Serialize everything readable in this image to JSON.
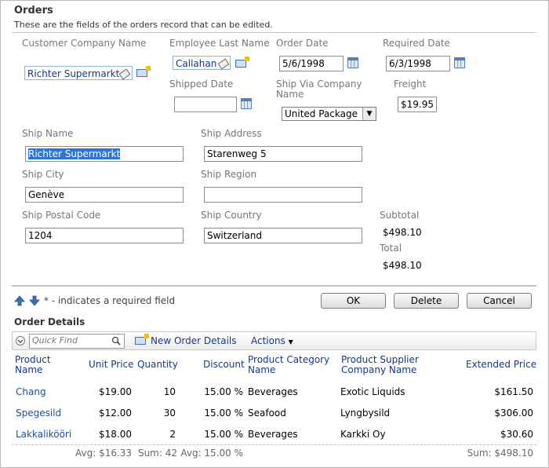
{
  "form": {
    "title": "Orders",
    "description": "These are the fields of the orders record that can be edited.",
    "customer_company_label": "Customer Company Name",
    "customer_company_value": "Richter Supermarkt",
    "employee_last_name_label": "Employee Last Name",
    "employee_last_name_value": "Callahan",
    "order_date_label": "Order Date",
    "order_date_value": "5/6/1998",
    "required_date_label": "Required Date",
    "required_date_value": "6/3/1998",
    "shipped_date_label": "Shipped Date",
    "shipped_date_value": "",
    "ship_via_label": "Ship Via Company Name",
    "ship_via_value": "United Package",
    "freight_label": "Freight",
    "freight_value": "$19.95",
    "ship_name_label": "Ship Name",
    "ship_name_value": "Richter Supermarkt",
    "ship_address_label": "Ship Address",
    "ship_address_value": "Starenweg 5",
    "ship_city_label": "Ship City",
    "ship_city_value": "Genève",
    "ship_region_label": "Ship Region",
    "ship_region_value": "",
    "ship_postal_code_label": "Ship Postal Code",
    "ship_postal_code_value": "1204",
    "ship_country_label": "Ship Country",
    "ship_country_value": "Switzerland",
    "subtotal_label": "Subtotal",
    "subtotal_value": "$498.10",
    "total_label": "Total",
    "total_value": "$498.10"
  },
  "actions_bar": {
    "required_note": "* - indicates a required field",
    "ok_label": "OK",
    "delete_label": "Delete",
    "cancel_label": "Cancel"
  },
  "details": {
    "title": "Order Details",
    "quick_find_placeholder": "Quick Find",
    "new_label": "New Order Details",
    "actions_label": "Actions",
    "columns": {
      "product_name": "Product Name",
      "unit_price": "Unit Price",
      "quantity": "Quantity",
      "discount": "Discount",
      "category": "Product Category Name",
      "supplier": "Product Supplier Company Name",
      "extended_price": "Extended Price"
    },
    "rows": [
      {
        "product_name": "Chang",
        "unit_price": "$19.00",
        "quantity": "10",
        "discount": "15.00 %",
        "category": "Beverages",
        "supplier": "Exotic Liquids",
        "extended_price": "$161.50"
      },
      {
        "product_name": "Spegesild",
        "unit_price": "$12.00",
        "quantity": "30",
        "discount": "15.00 %",
        "category": "Seafood",
        "supplier": "Lyngbysild",
        "extended_price": "$306.00"
      },
      {
        "product_name": "Lakkalikööri",
        "unit_price": "$18.00",
        "quantity": "2",
        "discount": "15.00 %",
        "category": "Beverages",
        "supplier": "Karkki Oy",
        "extended_price": "$30.60"
      }
    ],
    "footer": {
      "unit_price": "Avg: $16.33",
      "quantity": "Sum: 42",
      "discount": "Avg: 15.00 %",
      "extended_price": "Sum: $498.10"
    }
  }
}
